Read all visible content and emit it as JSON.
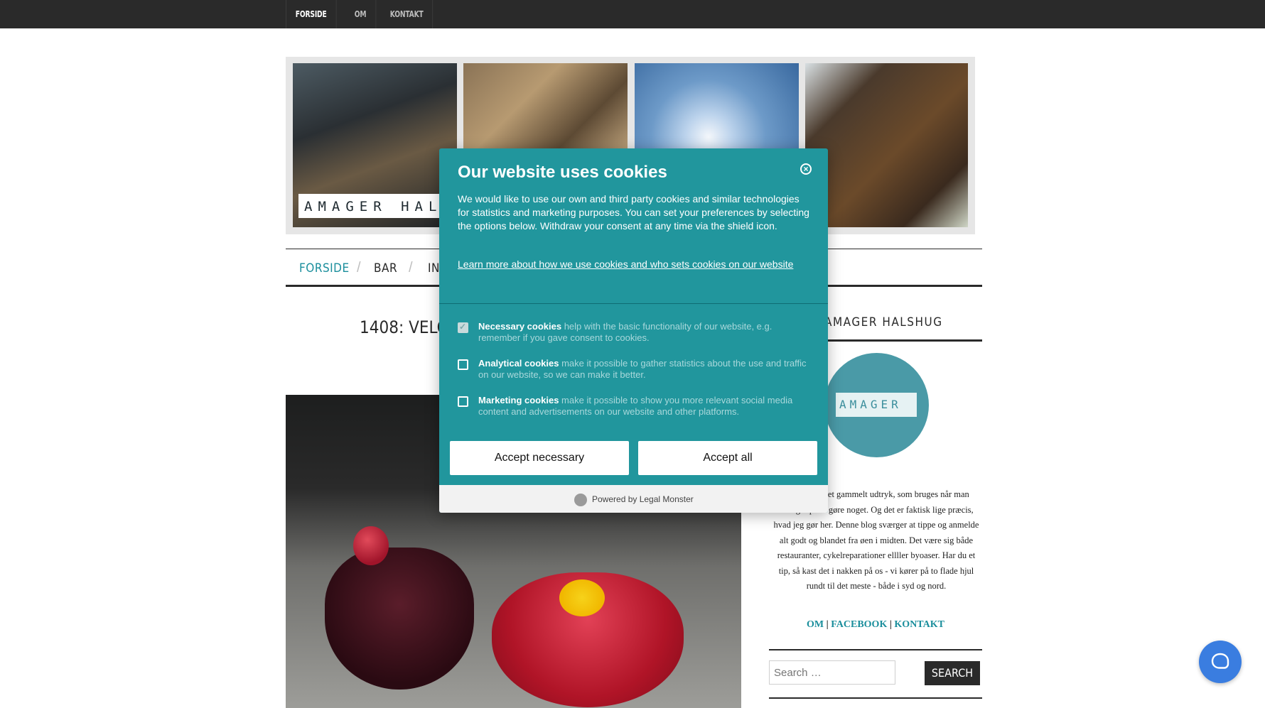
{
  "topnav": {
    "items": [
      "FORSIDE",
      "OM",
      "KONTAKT"
    ]
  },
  "header": {
    "logo_text": "AMAGER HALS"
  },
  "mainnav": {
    "items": [
      "FORSIDE",
      "BAR",
      "IN"
    ]
  },
  "post": {
    "title": "1408: VELOU"
  },
  "sidebar": {
    "title": "AMAGER HALSHUG",
    "avatar_text": "AMAGER",
    "about_text": "Halshug\" er et gammelt udtryk, som bruges når man sværger på at gøre noget. Og det er faktisk lige præcis, hvad jeg gør her. Denne blog sværger at tippe og anmelde alt godt og blandet fra øen i midten. Det være sig både restauranter, cykelreparationer ellller byoaser. Har du et tip, så kast det i nakken på os - vi kører på to flade hjul rundt til det meste - både i syd og nord.",
    "links": {
      "om": "OM",
      "facebook": "FACEBOOK",
      "kontakt": "KONTAKT",
      "sep": "|"
    },
    "search_placeholder": "Search …",
    "search_button": "SEARCH"
  },
  "cookie": {
    "title": "Our website uses cookies",
    "description": "We would like to use our own and third party cookies and similar technologies for statistics and marketing purposes. You can set your preferences by selecting the options below. Withdraw your consent at any time via the shield icon.",
    "learn_more": "Learn more about how we use cookies and who sets cookies on our website",
    "options": [
      {
        "name": "Necessary cookies",
        "text": " help with the basic functionality of our website, e.g. remember if you gave consent to cookies.",
        "checked": true
      },
      {
        "name": "Analytical cookies",
        "text": " make it possible to gather statistics about the use and traffic on our website, so we can make it better.",
        "checked": false
      },
      {
        "name": "Marketing cookies",
        "text": " make it possible to show you more relevant social media content and advertisements on our website and other platforms.",
        "checked": false
      }
    ],
    "accept_necessary": "Accept necessary",
    "accept_all": "Accept all",
    "powered_by": "Powered by Legal Monster"
  },
  "colors": {
    "cookie_bg": "#21969d",
    "accent": "#1a8e9c",
    "chat": "#3a7de0",
    "dark": "#2a2a2a"
  },
  "icons": {
    "close": "close-circle-icon",
    "chat": "chat-bubble-icon",
    "legal_monster": "legal-monster-icon"
  }
}
